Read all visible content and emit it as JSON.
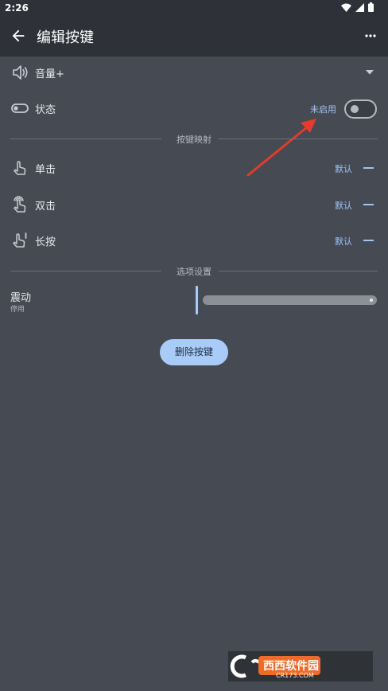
{
  "status_bar": {
    "time": "2:26"
  },
  "app_bar": {
    "title": "编辑按键"
  },
  "key_row": {
    "label": "音量+"
  },
  "state_row": {
    "label": "状态",
    "status": "未启用",
    "enabled": false
  },
  "sections": {
    "mapping": "按键映射",
    "options": "选项设置"
  },
  "mapping_rows": [
    {
      "label": "单击",
      "value": "默认"
    },
    {
      "label": "双击",
      "value": "默认"
    },
    {
      "label": "长按",
      "value": "默认"
    }
  ],
  "vibration": {
    "label": "震动",
    "sub": "停用",
    "level": 0
  },
  "delete_button": {
    "label": "删除按键"
  },
  "watermark": {
    "text": "西西软件园",
    "sub": "CR173.COM"
  },
  "colors": {
    "accent": "#9fc4f5",
    "background": "#464a52",
    "appbar": "#2e3137",
    "arrow": "#e33b2e"
  }
}
